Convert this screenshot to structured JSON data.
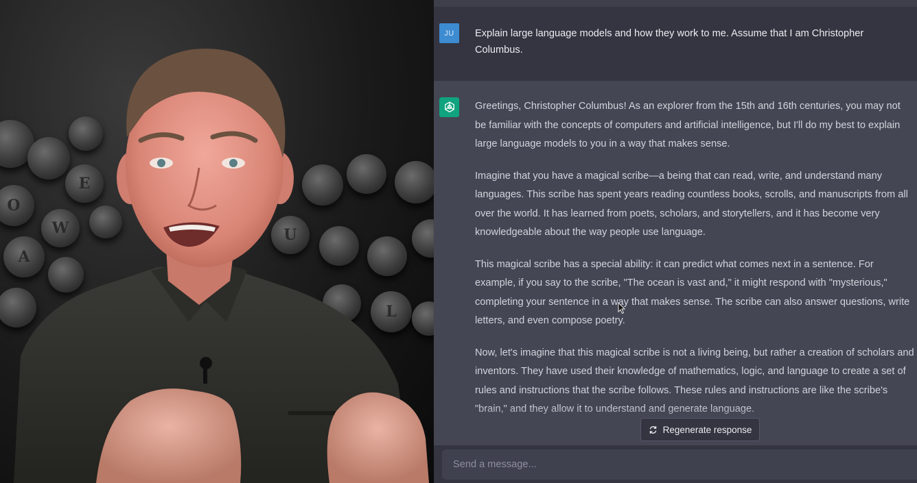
{
  "chat": {
    "user": {
      "avatar_initials": "JU",
      "message": "Explain large language models and how they work to me. Assume that I am Christopher Columbus."
    },
    "assistant": {
      "avatar_icon": "openai-logo-icon",
      "paragraphs": [
        "Greetings, Christopher Columbus! As an explorer from the 15th and 16th centuries, you may not be familiar with the concepts of computers and artificial intelligence, but I'll do my best to explain large language models to you in a way that makes sense.",
        "Imagine that you have a magical scribe—a being that can read, write, and understand many languages. This scribe has spent years reading countless books, scrolls, and manuscripts from all over the world. It has learned from poets, scholars, and storytellers, and it has become very knowledgeable about the way people use language.",
        "This magical scribe has a special ability: it can predict what comes next in a sentence. For example, if you say to the scribe, \"The ocean is vast and,\" it might respond with \"mysterious,\" completing your sentence in a way that makes sense. The scribe can also answer questions, write letters, and even compose poetry.",
        "Now, let's imagine that this magical scribe is not a living being, but rather a creation of scholars and inventors. They have used their knowledge of mathematics, logic, and language to create a set of rules and instructions that the scribe follows. These rules and instructions are like the scribe's \"brain,\" and they allow it to understand and generate language."
      ]
    },
    "regenerate_label": "Regenerate response",
    "composer_placeholder": "Send a message..."
  },
  "video": {
    "typewriter_keys": [
      "W",
      "A",
      "O",
      "L",
      "U",
      "E"
    ]
  },
  "colors": {
    "chat_bg": "#444654",
    "user_row_bg": "#343541",
    "gpt_green": "#10a37f",
    "user_avatar_blue": "#3d8bd1"
  }
}
